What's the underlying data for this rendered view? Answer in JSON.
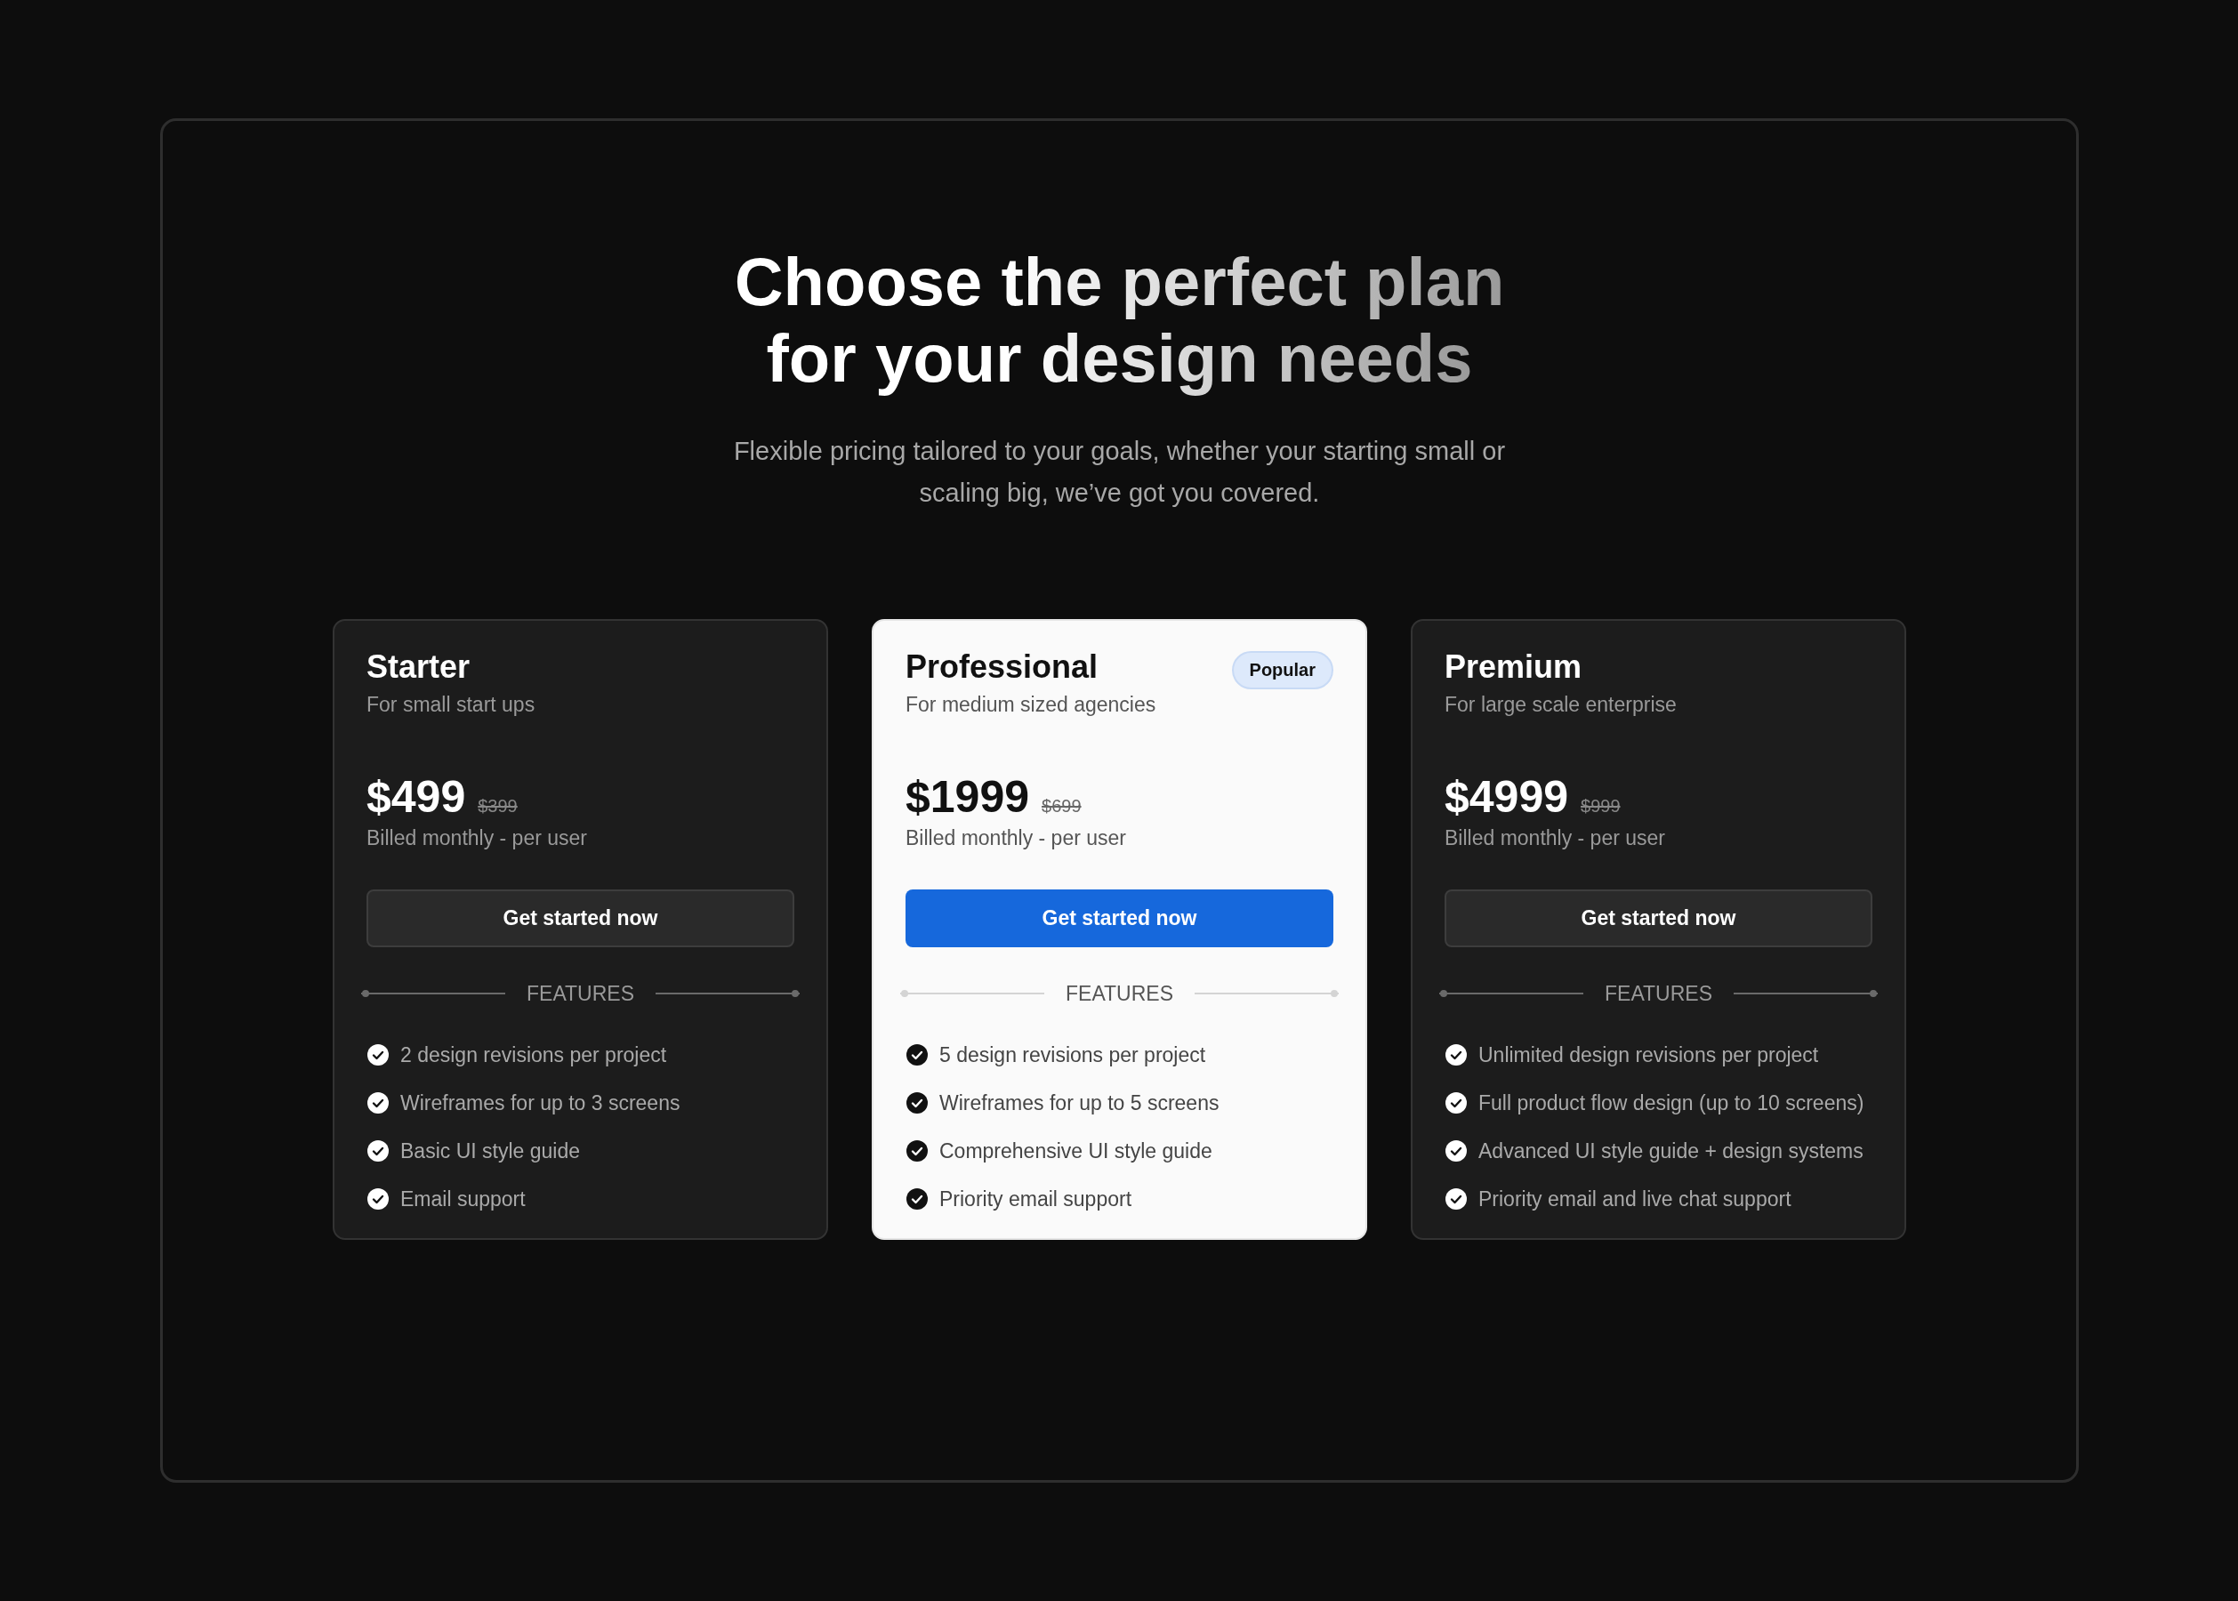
{
  "heading": {
    "line_1": "Choose the perfect plan",
    "line_2": "for your design needs"
  },
  "subtitle": "Flexible pricing tailored to your goals, whether your starting small or scaling big, we’ve got you covered.",
  "plans": [
    {
      "name": "Starter",
      "tagline": "For small start ups",
      "price": "$499",
      "old_price": "$399",
      "billing": "Billed monthly - per user",
      "button": "Get started now",
      "featured": false,
      "features_label": "FEATURES",
      "features": [
        "2 design revisions per project",
        "Wireframes for up to 3 screens",
        "Basic UI style guide",
        "Email support"
      ]
    },
    {
      "name": "Professional",
      "tagline": "For medium sized agencies",
      "badge": "Popular",
      "price": "$1999",
      "old_price": "$699",
      "billing": "Billed monthly - per user",
      "button": "Get started now",
      "featured": true,
      "features_label": "FEATURES",
      "features": [
        "5 design revisions per project",
        "Wireframes for up to 5 screens",
        "Comprehensive UI style guide",
        "Priority email support"
      ]
    },
    {
      "name": "Premium",
      "tagline": "For large scale enterprise",
      "price": "$4999",
      "old_price": "$999",
      "billing": "Billed monthly - per user",
      "button": "Get started now",
      "featured": false,
      "features_label": "FEATURES",
      "features": [
        "Unlimited design revisions per project",
        "Full product flow design (up to 10 screens)",
        "Advanced UI style guide + design systems",
        "Priority email and live chat support"
      ]
    }
  ]
}
